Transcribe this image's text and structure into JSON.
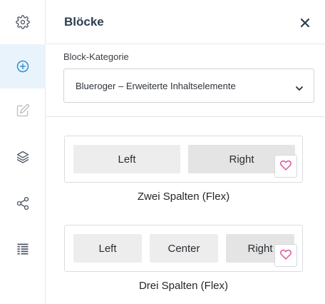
{
  "sidebar": {
    "items": [
      {
        "icon": "gear-icon",
        "active": false
      },
      {
        "icon": "plus-circle-icon",
        "active": true
      },
      {
        "icon": "edit-icon",
        "active": false
      },
      {
        "icon": "layers-icon",
        "active": false
      },
      {
        "icon": "share-icon",
        "active": false
      },
      {
        "icon": "list-icon",
        "active": false
      }
    ]
  },
  "panel": {
    "title": "Blöcke",
    "close_icon": "close-icon"
  },
  "category": {
    "label": "Block-Kategorie",
    "selected": "Blueroger – Erweiterte Inhaltselemente"
  },
  "blocks": [
    {
      "cells": [
        "Left",
        "Right"
      ],
      "caption": "Zwei Spalten (Flex)"
    },
    {
      "cells": [
        "Left",
        "Center",
        "Right"
      ],
      "caption": "Drei Spalten (Flex)"
    }
  ],
  "colors": {
    "accent": "#2e90d6",
    "active_bg": "#e9f3fc",
    "icon_gray": "#4a5560",
    "favorite_pink": "#e0529c"
  }
}
